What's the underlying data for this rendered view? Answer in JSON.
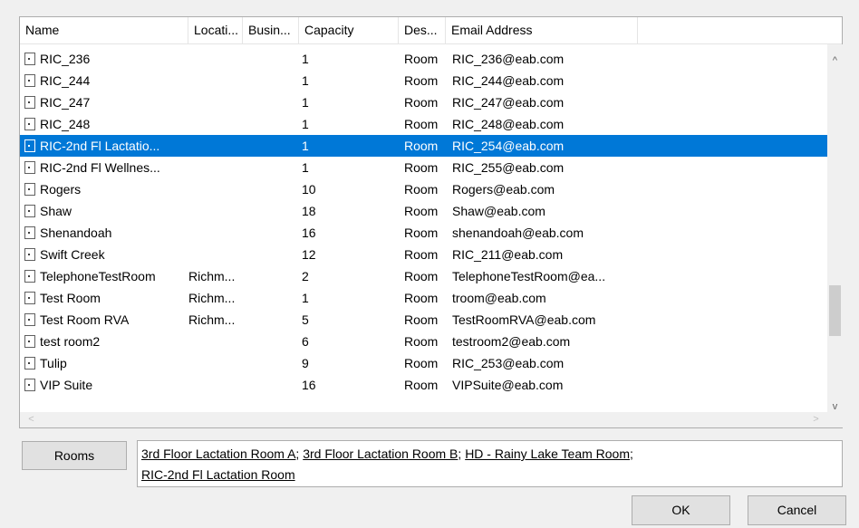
{
  "columns": [
    {
      "label": "Name"
    },
    {
      "label": "Locati..."
    },
    {
      "label": "Busin..."
    },
    {
      "label": "Capacity"
    },
    {
      "label": "Des..."
    },
    {
      "label": "Email Address"
    }
  ],
  "rows": [
    {
      "name": "RIC_236",
      "location": "",
      "business": "",
      "capacity": "1",
      "desc": "Room",
      "email": "RIC_236@eab.com",
      "selected": false
    },
    {
      "name": "RIC_244",
      "location": "",
      "business": "",
      "capacity": "1",
      "desc": "Room",
      "email": "RIC_244@eab.com",
      "selected": false
    },
    {
      "name": "RIC_247",
      "location": "",
      "business": "",
      "capacity": "1",
      "desc": "Room",
      "email": "RIC_247@eab.com",
      "selected": false
    },
    {
      "name": "RIC_248",
      "location": "",
      "business": "",
      "capacity": "1",
      "desc": "Room",
      "email": "RIC_248@eab.com",
      "selected": false
    },
    {
      "name": "RIC-2nd Fl Lactatio...",
      "location": "",
      "business": "",
      "capacity": "1",
      "desc": "Room",
      "email": "RIC_254@eab.com",
      "selected": true
    },
    {
      "name": "RIC-2nd Fl Wellnes...",
      "location": "",
      "business": "",
      "capacity": "1",
      "desc": "Room",
      "email": "RIC_255@eab.com",
      "selected": false
    },
    {
      "name": "Rogers",
      "location": "",
      "business": "",
      "capacity": "10",
      "desc": "Room",
      "email": "Rogers@eab.com",
      "selected": false
    },
    {
      "name": "Shaw",
      "location": "",
      "business": "",
      "capacity": "18",
      "desc": "Room",
      "email": "Shaw@eab.com",
      "selected": false
    },
    {
      "name": "Shenandoah",
      "location": "",
      "business": "",
      "capacity": "16",
      "desc": "Room",
      "email": "shenandoah@eab.com",
      "selected": false
    },
    {
      "name": "Swift Creek",
      "location": "",
      "business": "",
      "capacity": "12",
      "desc": "Room",
      "email": "RIC_211@eab.com",
      "selected": false
    },
    {
      "name": "TelephoneTestRoom",
      "location": "Richm...",
      "business": "",
      "capacity": "2",
      "desc": "Room",
      "email": "TelephoneTestRoom@ea...",
      "selected": false
    },
    {
      "name": "Test Room",
      "location": "Richm...",
      "business": "",
      "capacity": "1",
      "desc": "Room",
      "email": "troom@eab.com",
      "selected": false
    },
    {
      "name": "Test Room RVA",
      "location": "Richm...",
      "business": "",
      "capacity": "5",
      "desc": "Room",
      "email": "TestRoomRVA@eab.com",
      "selected": false
    },
    {
      "name": "test room2",
      "location": "",
      "business": "",
      "capacity": "6",
      "desc": "Room",
      "email": "testroom2@eab.com",
      "selected": false
    },
    {
      "name": "Tulip",
      "location": "",
      "business": "",
      "capacity": "9",
      "desc": "Room",
      "email": "RIC_253@eab.com",
      "selected": false
    },
    {
      "name": "VIP Suite",
      "location": "",
      "business": "",
      "capacity": "16",
      "desc": "Room",
      "email": "VIPSuite@eab.com",
      "selected": false
    }
  ],
  "scroll_arrows": {
    "up": "^",
    "down": "v",
    "left": "<",
    "right": ">"
  },
  "rooms_button": {
    "label": "Rooms"
  },
  "selected_rooms": [
    {
      "name": "3rd Floor Lactation Room A",
      "sep": "; "
    },
    {
      "name": "3rd Floor Lactation Room B",
      "sep": "; "
    },
    {
      "name": "HD - Rainy Lake Team Room",
      "sep": ";"
    },
    {
      "name": "RIC-2nd Fl Lactation Room",
      "sep": ""
    }
  ],
  "ok_button": {
    "label": "OK"
  },
  "cancel_button": {
    "label": "Cancel"
  }
}
